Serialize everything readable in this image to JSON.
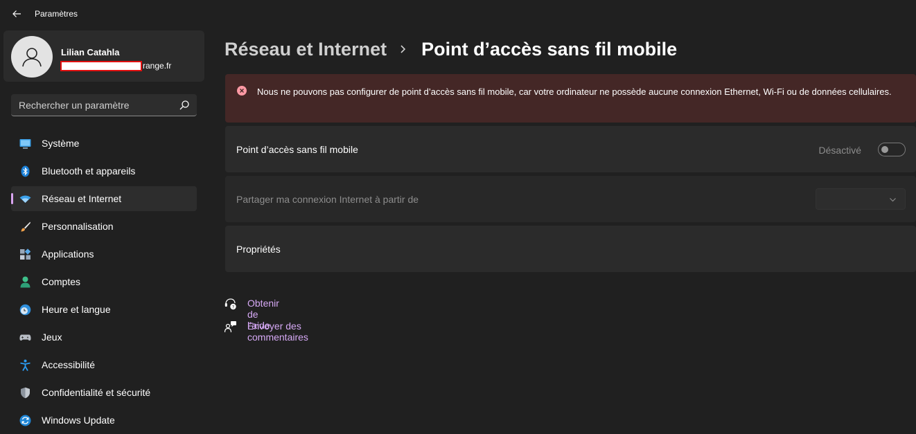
{
  "window": {
    "title": "Paramètres"
  },
  "profile": {
    "name": "Lilian Catahla",
    "email_visible": "range.fr"
  },
  "search": {
    "placeholder": "Rechercher un paramètre"
  },
  "sidebar": {
    "items": [
      {
        "label": "Système",
        "icon": "system-icon",
        "active": false
      },
      {
        "label": "Bluetooth et appareils",
        "icon": "bluetooth-icon",
        "active": false
      },
      {
        "label": "Réseau et Internet",
        "icon": "wifi-icon",
        "active": true
      },
      {
        "label": "Personnalisation",
        "icon": "brush-icon",
        "active": false
      },
      {
        "label": "Applications",
        "icon": "apps-icon",
        "active": false
      },
      {
        "label": "Comptes",
        "icon": "account-icon",
        "active": false
      },
      {
        "label": "Heure et langue",
        "icon": "globe-clock-icon",
        "active": false
      },
      {
        "label": "Jeux",
        "icon": "gamepad-icon",
        "active": false
      },
      {
        "label": "Accessibilité",
        "icon": "accessibility-icon",
        "active": false
      },
      {
        "label": "Confidentialité et sécurité",
        "icon": "shield-icon",
        "active": false
      },
      {
        "label": "Windows Update",
        "icon": "update-icon",
        "active": false
      }
    ]
  },
  "breadcrumb": {
    "parent": "Réseau et Internet",
    "current": "Point d’accès sans fil mobile"
  },
  "error": {
    "message": "Nous ne pouvons pas configurer de point d’accès sans fil mobile, car votre ordinateur ne possède aucune connexion Ethernet, Wi-Fi ou de données cellulaires."
  },
  "settings": {
    "hotspot": {
      "label": "Point d’accès sans fil mobile",
      "state_label": "Désactivé",
      "on": false
    },
    "share": {
      "label": "Partager ma connexion Internet à partir de",
      "value": ""
    },
    "properties": {
      "label": "Propriétés"
    }
  },
  "links": {
    "help": "Obtenir de l’aide",
    "feedback": "Envoyer des commentaires"
  },
  "colors": {
    "background": "#202020",
    "card": "#2b2b2b",
    "accent": "#d6a9f5",
    "error_bg": "#442726",
    "error_icon": "#ff99a4"
  }
}
